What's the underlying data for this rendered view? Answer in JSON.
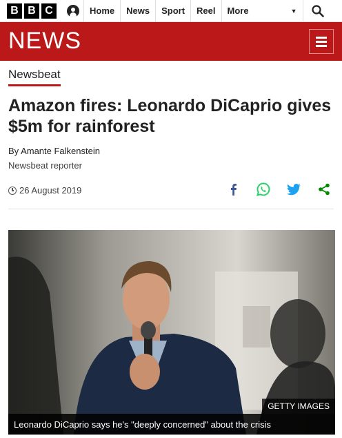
{
  "brand": {
    "letters": [
      "B",
      "B",
      "C"
    ]
  },
  "nav": {
    "items": [
      "Home",
      "News",
      "Sport",
      "Reel"
    ],
    "more_label": "More"
  },
  "news_logo": "NEWS",
  "article": {
    "section": "Newsbeat",
    "headline": "Amazon fires: Leonardo DiCaprio gives $5m for rainforest",
    "byline": "By Amante Falkenstein",
    "role": "Newsbeat reporter",
    "date": "26 August 2019"
  },
  "share": {
    "icons": [
      "facebook-icon",
      "whatsapp-icon",
      "twitter-icon",
      "share-icon"
    ],
    "colors": {
      "facebook": "#3b5998",
      "whatsapp": "#25d366",
      "twitter": "#1da1f2",
      "share": "#008a00"
    }
  },
  "image": {
    "credit": "GETTY IMAGES",
    "caption": "Leonardo DiCaprio says he's \"deeply concerned\" about the crisis"
  },
  "colors": {
    "accent": "#bb1919"
  }
}
